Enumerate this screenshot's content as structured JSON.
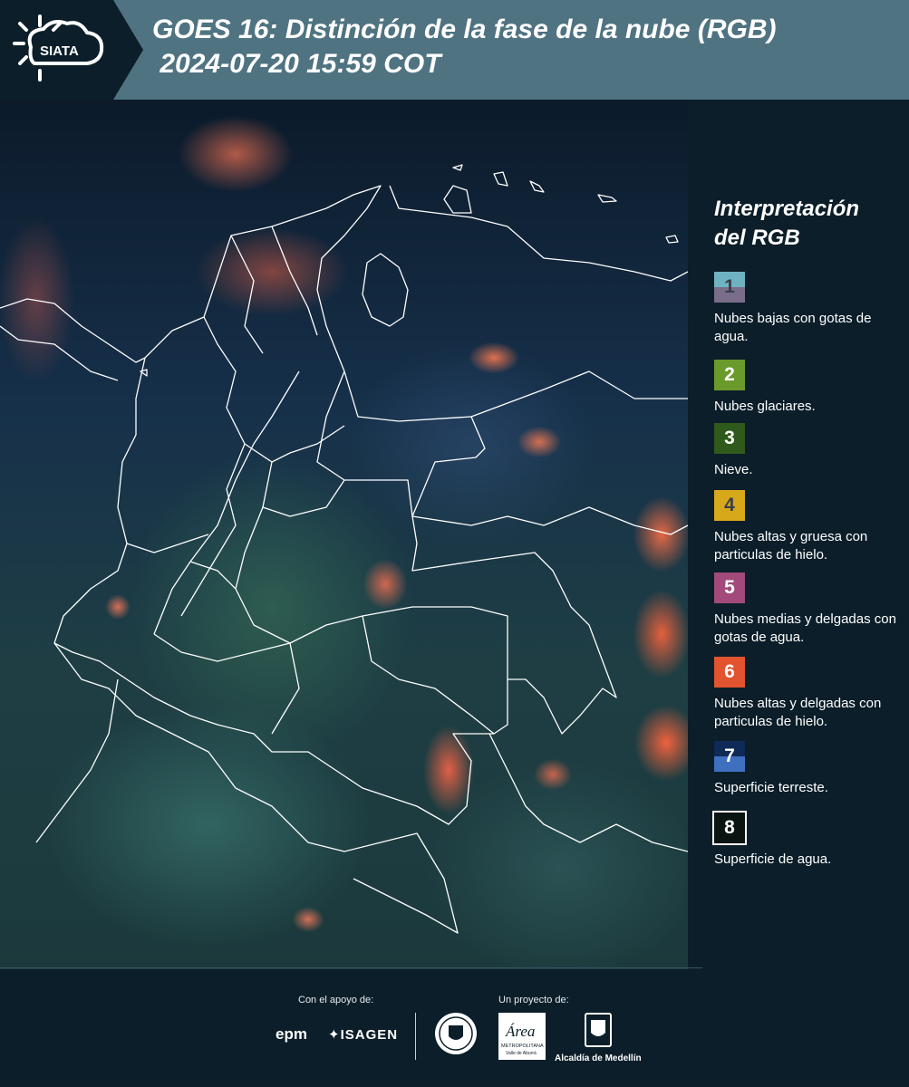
{
  "header": {
    "title": "GOES 16: Distinción de la fase de la nube (RGB)\n 2024-07-20 15:59 COT",
    "logo_text": "SIATA",
    "logo_icon": "sun-cloud-icon"
  },
  "map": {
    "description_icon": "satellite-rgb-map",
    "boundary_color": "#ffffff"
  },
  "legend": {
    "title": "Interpretación del RGB",
    "items": [
      {
        "number": "1",
        "label": "Nubes bajas con gotas de agua.",
        "color_top": "#6fb3c2",
        "color_bottom": "#7a6d8a",
        "num_color": "#3b3f4a"
      },
      {
        "number": "2",
        "label": "Nubes glaciares.",
        "color": "#6a9a2c",
        "num_color": "#ffffff"
      },
      {
        "number": "3",
        "label": "Nieve.",
        "color": "#2f5a1c",
        "num_color": "#ffffff"
      },
      {
        "number": "4",
        "label": "Nubes altas y gruesa con particulas de hielo.",
        "color": "#d8a81b",
        "num_color": "#3b3f4a"
      },
      {
        "number": "5",
        "label": "Nubes medias y delgadas con gotas de agua.",
        "color": "#a24a7c",
        "num_color": "#ffffff"
      },
      {
        "number": "6",
        "label": "Nubes altas y delgadas con particulas de hielo.",
        "color": "#e2532f",
        "num_color": "#ffffff"
      },
      {
        "number": "7",
        "label": "Superficie terreste.",
        "color_top": "#102a57",
        "color_bottom": "#3f6fbf",
        "num_color": "#ffffff"
      },
      {
        "number": "8",
        "label": "Superficie de agua.",
        "color": "#0a1410",
        "border": "#ffffff",
        "num_color": "#ffffff"
      }
    ]
  },
  "footer": {
    "support_label": "Con el apoyo de:",
    "project_label": "Un proyecto de:",
    "epm": "epm",
    "isagen": "ISAGEN",
    "amva_word": "Área",
    "amva_sub1": "METROPOLITANA",
    "amva_sub2": "Valle de Aburrá",
    "alcaldia": "Alcaldía de Medellín"
  }
}
